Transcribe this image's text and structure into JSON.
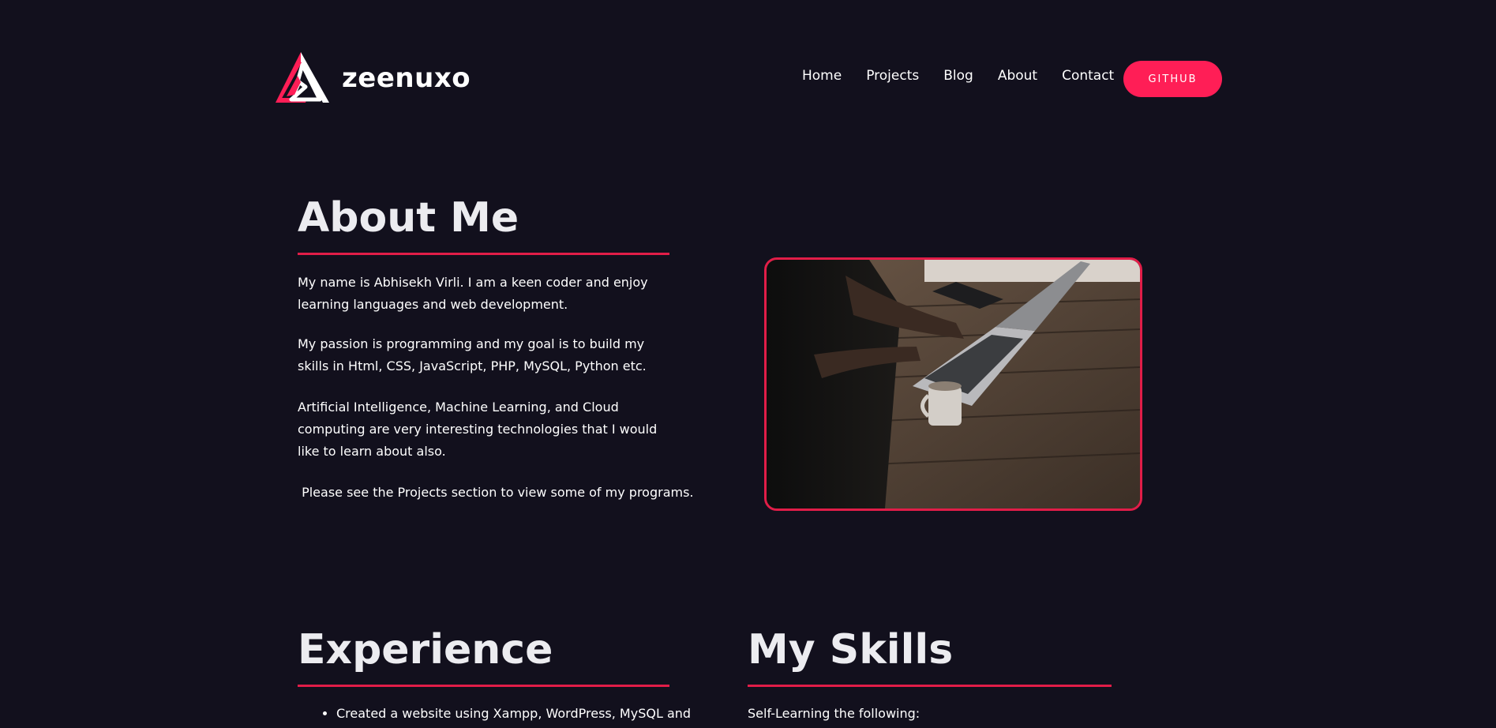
{
  "brand": {
    "name": "zeenuxo",
    "accent_color": "#ff1e56",
    "logo_icon": "triangle-logo-icon"
  },
  "nav": {
    "items": [
      {
        "label": "Home"
      },
      {
        "label": "Projects"
      },
      {
        "label": "Blog"
      },
      {
        "label": "About"
      },
      {
        "label": "Contact"
      }
    ],
    "github_label": "GITHUB"
  },
  "about": {
    "title": "About Me",
    "paragraphs": [
      "My name is Abhisekh Virli. I am a keen coder and enjoy learning languages and web development.",
      "My passion is programming and my goal is to build my skills in Html, CSS, JavaScript, PHP, MySQL, Python etc.",
      "Artificial Intelligence, Machine Learning, and Cloud computing are very interesting technologies that I would like to learn about also.",
      " Please see the Projects section to view some of my programs."
    ],
    "image_icon": "laptop-photo"
  },
  "experience": {
    "title": "Experience",
    "items": [
      "Created a website using Xampp, WordPress, MySQL and"
    ]
  },
  "skills": {
    "title": "My Skills",
    "intro": "Self-Learning the following:"
  }
}
